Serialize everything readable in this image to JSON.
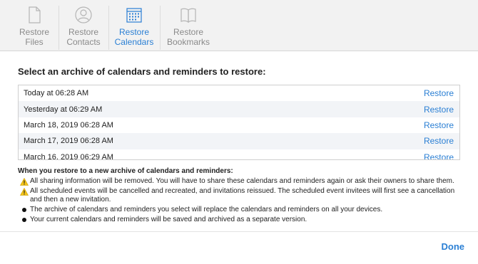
{
  "colors": {
    "accent": "#2a7fd4",
    "warning": "#f5c518",
    "toolbar_bg": "#f2f2f2"
  },
  "tabs": [
    {
      "line1": "Restore",
      "line2": "Files",
      "icon": "document-icon",
      "active": false
    },
    {
      "line1": "Restore",
      "line2": "Contacts",
      "icon": "person-icon",
      "active": false
    },
    {
      "line1": "Restore",
      "line2": "Calendars",
      "icon": "calendar-icon",
      "active": true
    },
    {
      "line1": "Restore",
      "line2": "Bookmarks",
      "icon": "book-icon",
      "active": false
    }
  ],
  "heading": "Select an archive of calendars and reminders to restore:",
  "archives": [
    {
      "date": "Today at 06:28 AM",
      "action": "Restore"
    },
    {
      "date": "Yesterday at 06:29 AM",
      "action": "Restore"
    },
    {
      "date": "March 18, 2019 06:28 AM",
      "action": "Restore"
    },
    {
      "date": "March 17, 2019 06:28 AM",
      "action": "Restore"
    },
    {
      "date": "March 16, 2019 06:29 AM",
      "action": "Restore"
    }
  ],
  "notes": {
    "title": "When you restore to a new archive of calendars and reminders:",
    "items": [
      {
        "type": "warning",
        "icon": "warning-icon",
        "text": "All sharing information will be removed. You will have to share these calendars and reminders again or ask their owners to share them."
      },
      {
        "type": "warning",
        "icon": "warning-icon",
        "text": "All scheduled events will be cancelled and recreated, and invitations reissued. The scheduled event invitees will first see a cancellation and then a new invitation."
      },
      {
        "type": "bullet",
        "icon": "bullet-icon",
        "text": "The archive of calendars and reminders you select will replace the calendars and reminders on all your devices."
      },
      {
        "type": "bullet",
        "icon": "bullet-icon",
        "text": "Your current calendars and reminders will be saved and archived as a separate version."
      }
    ]
  },
  "done_label": "Done"
}
